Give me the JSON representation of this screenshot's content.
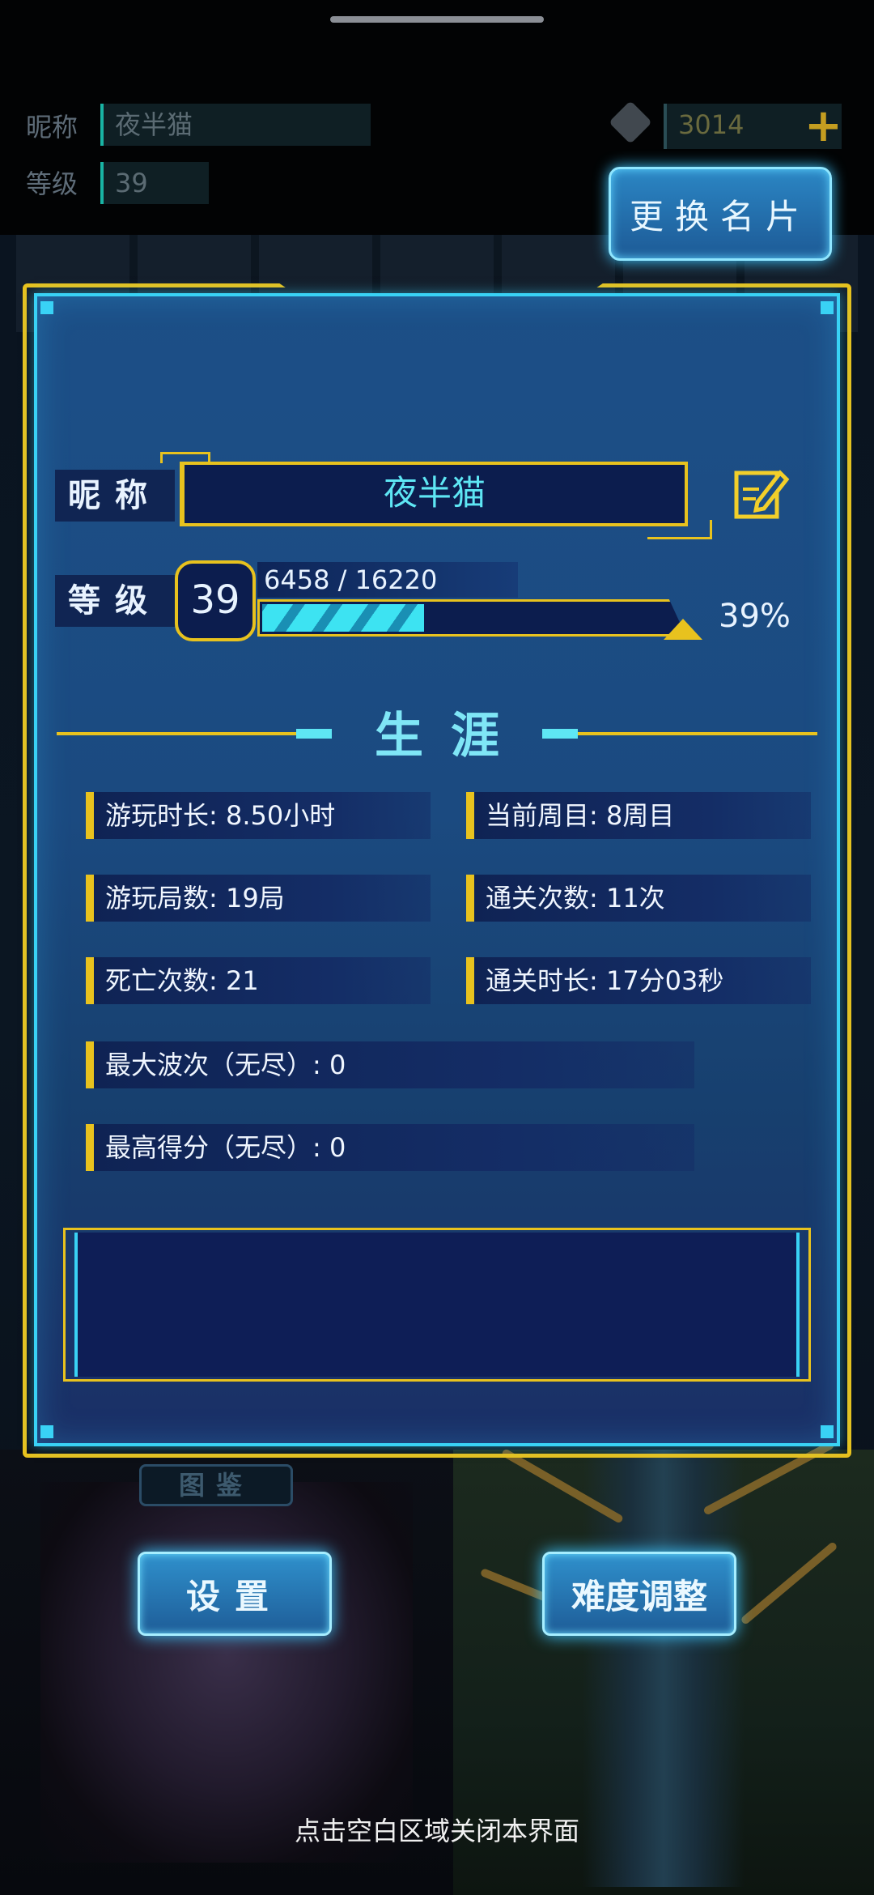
{
  "top_info": {
    "nickname_label": "昵称",
    "nickname_value": "夜半猫",
    "level_label": "等级",
    "level_value": "39",
    "coins": "3014",
    "coin_plus": "+",
    "change_card_button": "更换名片"
  },
  "profile": {
    "nickname_label": "昵称",
    "nickname": "夜半猫",
    "level_label": "等级",
    "level": "39",
    "xp_text": "6458 / 16220",
    "xp_current": 6458,
    "xp_total": 16220,
    "xp_percent_text": "39%",
    "xp_fraction": 0.398
  },
  "career": {
    "title": "生涯",
    "stats": [
      {
        "text": "游玩时长: 8.50小时"
      },
      {
        "text": "当前周目: 8周目"
      },
      {
        "text": "游玩局数: 19局"
      },
      {
        "text": "通关次数: 11次"
      },
      {
        "text": "死亡次数: 21"
      },
      {
        "text": "通关时长: 17分03秒"
      },
      {
        "text": "最大波次（无尽）: 0"
      },
      {
        "text": "最高得分（无尽）: 0"
      }
    ]
  },
  "background": {
    "codex_label": "图鉴"
  },
  "buttons": {
    "settings": "设置",
    "difficulty": "难度调整"
  },
  "hint": "点击空白区域关闭本界面",
  "colors": {
    "accent_gold": "#e8c21e",
    "accent_cyan": "#39d2f5",
    "panel_blue": "#1c4f87"
  }
}
